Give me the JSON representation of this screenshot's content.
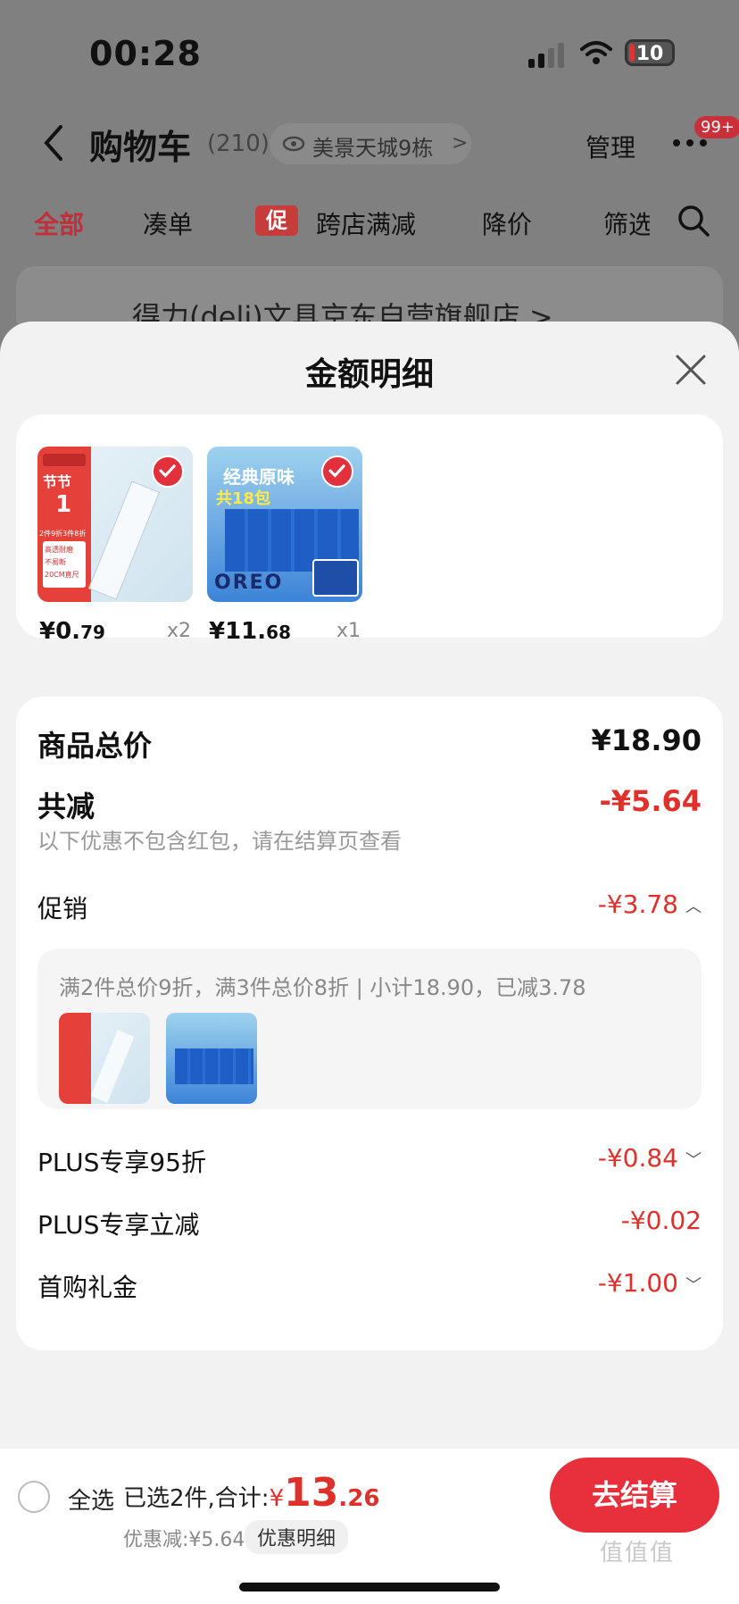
{
  "status_bar": {
    "time": "00:28",
    "battery": "10"
  },
  "nav": {
    "title": "购物车",
    "count": "(210)",
    "location": "美景天城9栋",
    "location_chevron": ">",
    "manage": "管理",
    "badge": "99+"
  },
  "tabs": [
    {
      "label": "全部"
    },
    {
      "label": "凑单"
    },
    {
      "label": "跨店满减",
      "tag": "促"
    },
    {
      "label": "降价"
    },
    {
      "label": "筛选"
    }
  ],
  "store": {
    "name": "得力(deli)文具京东自营旗舰店 >"
  },
  "sheet": {
    "title": "金额明细",
    "items": [
      {
        "name": "ruler",
        "price_int": "¥0.",
        "price_dec": "79",
        "qty": "x2",
        "thumb_title": "节节",
        "thumb_big": "1",
        "thumb_lines": [
          "2件9折3件8折",
          "高透耐磨",
          "不易断",
          "20CM直尺"
        ]
      },
      {
        "name": "oreo",
        "price_int": "¥11.",
        "price_dec": "68",
        "qty": "x1",
        "thumb_title": "经典原味",
        "thumb_sub": "共18包",
        "thumb_logo": "OREO"
      }
    ],
    "details": {
      "total_label": "商品总价",
      "total_value": "¥18.90",
      "reduce_label": "共减",
      "reduce_value": "-¥5.64",
      "reduce_note": "以下优惠不包含红包，请在结算页查看",
      "promo_label": "促销",
      "promo_value": "-¥3.78",
      "promo_desc": "满2件总价9折，满3件总价8折 | 小计18.90，已减3.78",
      "plus95_label": "PLUS专享95折",
      "plus95_value": "-¥0.84",
      "plus_reduce_label": "PLUS专享立减",
      "plus_reduce_value": "-¥0.02",
      "first_buy_label": "首购礼金",
      "first_buy_value": "-¥1.00"
    }
  },
  "bottom": {
    "select_all": "全选",
    "summary_prefix": "已选2件,合计:",
    "total_yen": "¥",
    "total_int": "13",
    "total_dec": ".26",
    "discount": "优惠减:¥5.64",
    "discount_detail": "优惠明细",
    "checkout": "去结算",
    "watermark": "值值值"
  },
  "colors": {
    "accent": "#e0302b",
    "checkout": "#e7303c",
    "sheet_bg": "#f2f2f2"
  }
}
